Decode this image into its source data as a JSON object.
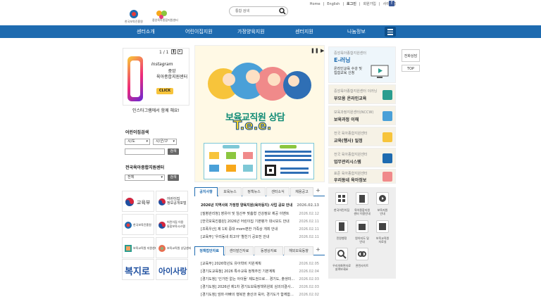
{
  "util": {
    "home": "Home",
    "english": "English",
    "login": "로그인",
    "join": "회원가입",
    "sitemap": "사이트맵",
    "facebook": "f"
  },
  "logos": {
    "logo1": "한국보육진흥원",
    "logo2": "중앙육아종합지원센터"
  },
  "search": {
    "placeholder": "통합 검색"
  },
  "gnb": [
    "센터소개",
    "어린이집지원",
    "가정양육지원",
    "센터지원",
    "나눔정보"
  ],
  "insta": {
    "page": "1 / 1",
    "brand": "Instagram",
    "sub": "중앙\n육아종합지원센터",
    "click": "CLICK",
    "caption": "인스타그램에서 함께 해요!"
  },
  "daycare_search": {
    "title": "어린이집검색",
    "sido": "시/도",
    "sigungu": "시/군/구",
    "btn": "검색"
  },
  "center_search": {
    "title": "전국육아종합지원센터",
    "all": "전체",
    "btn": "검색"
  },
  "banners": [
    {
      "label": "교육부"
    },
    {
      "label": "어린이집\n정보공개포털"
    },
    {
      "label": "한국보육진흥원"
    },
    {
      "label": "어린이집 이용\n통합보육시스템"
    },
    {
      "label": "보육교직원 지원센터"
    },
    {
      "label": "보육교직원 상담센터"
    },
    {
      "label": "복지로"
    },
    {
      "label": "아이사랑"
    }
  ],
  "poster": {
    "title": "보육교직원 상담",
    "brand": "T.e.e.",
    "controls": "❚❚ ▶"
  },
  "tabs1": [
    "공지사항",
    "보육뉴스",
    "정책뉴스",
    "센터소식",
    "채용공고"
  ],
  "news1": [
    {
      "t": "2026년 지역사회 가정형 양육지원(육아둥지) 사업 공모 안내",
      "d": "2026.02.13"
    },
    {
      "t": "[질병관리청] 영유아 및 임산부 맞춤형 건강정보 제공 이벤트",
      "d": "2026.02.12"
    },
    {
      "t": "[한국보육진흥원] 2026년 어린이집 기본평가 대시보드 안내",
      "d": "2026.02.11"
    },
    {
      "t": "[조폭우산] 제 1회 중대 mom편한 가족상 개최 안내",
      "d": "2026.02.11"
    },
    {
      "t": "[교육부] '우리동네 최고야' 별친기 공모전 안내",
      "d": "2026.02.11"
    }
  ],
  "tabs2": [
    "정책법안자료",
    "센터발간자료",
    "동영상자료",
    "해외보육동향"
  ],
  "news2": [
    {
      "t": "[교육부] 2026학년도 유아학비 지원계획",
      "d": "2026.02.05"
    },
    {
      "t": "[경기도교육청] 2026 특수교육 정책추진 기본계획",
      "d": "2026.02.04"
    },
    {
      "t": "[경기도청] '인가만 없는 아이들' 제도권으로... 경기도, 출생미...",
      "d": "2026.02.03"
    },
    {
      "t": "[경기도청] 2026년 제1차 경기도보육정책위원회 심의의결사...",
      "d": "2026.02.03"
    },
    {
      "t": "[경기도청] 엄마·아빠의 행복한 출산과 육아, 경기도가 함께합...",
      "d": "2026.02.02"
    }
  ],
  "right": [
    {
      "t1": "중앙육아종합지원센터",
      "t2": "E-러닝",
      "t3": "온라인교육 수강 및\n집합교육 신청"
    },
    {
      "t1": "중앙육아종합지원센터 이러닝",
      "t2": "부모용 온라인교육"
    },
    {
      "t1": "보육과정지원센터(NCCW)",
      "t2": "보육과정 이해"
    },
    {
      "t1": "전국 육아종합지원센터",
      "t2": "교육(행사) 일정"
    },
    {
      "t1": "전국 육아종합지원센터",
      "t2": "업무관리시스템"
    },
    {
      "t1": "표준 육아종합지원센터",
      "t2": "우리동네 육아정보"
    }
  ],
  "quick": [
    {
      "label": "한국어린이집"
    },
    {
      "label": "육아종합지원\n센터 이용안내"
    },
    {
      "label": "보육지원\n안내"
    },
    {
      "label": "민원행정"
    },
    {
      "label": "원아지도 및\n안내"
    },
    {
      "label": "보육교직원\n자료실"
    },
    {
      "label": "우리의화면자료\n살펴보세요"
    },
    {
      "label": "관련사이트"
    }
  ],
  "side": {
    "consult": "전화상담",
    "top": "TOP"
  },
  "colors": {
    "primary": "#1e6bb0",
    "accent": "#f7c43b"
  }
}
